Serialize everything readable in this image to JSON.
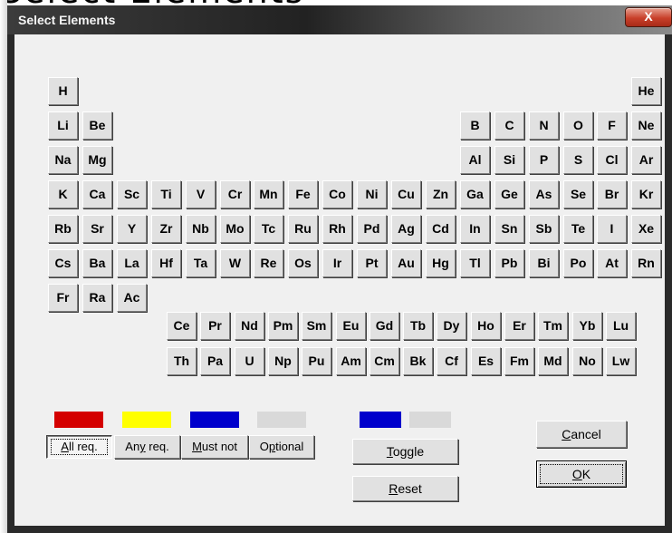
{
  "background_text": "Select Elements",
  "window": {
    "title": "Select Elements",
    "close_glyph": "X"
  },
  "main_rows": [
    [
      "H",
      null,
      null,
      null,
      null,
      null,
      null,
      null,
      null,
      null,
      null,
      null,
      null,
      null,
      null,
      null,
      null,
      "He"
    ],
    [
      "Li",
      "Be",
      null,
      null,
      null,
      null,
      null,
      null,
      null,
      null,
      null,
      null,
      "B",
      "C",
      "N",
      "O",
      "F",
      "Ne"
    ],
    [
      "Na",
      "Mg",
      null,
      null,
      null,
      null,
      null,
      null,
      null,
      null,
      null,
      null,
      "Al",
      "Si",
      "P",
      "S",
      "Cl",
      "Ar"
    ],
    [
      "K",
      "Ca",
      "Sc",
      "Ti",
      "V",
      "Cr",
      "Mn",
      "Fe",
      "Co",
      "Ni",
      "Cu",
      "Zn",
      "Ga",
      "Ge",
      "As",
      "Se",
      "Br",
      "Kr"
    ],
    [
      "Rb",
      "Sr",
      "Y",
      "Zr",
      "Nb",
      "Mo",
      "Tc",
      "Ru",
      "Rh",
      "Pd",
      "Ag",
      "Cd",
      "In",
      "Sn",
      "Sb",
      "Te",
      "I",
      "Xe"
    ],
    [
      "Cs",
      "Ba",
      "La",
      "Hf",
      "Ta",
      "W",
      "Re",
      "Os",
      "Ir",
      "Pt",
      "Au",
      "Hg",
      "Tl",
      "Pb",
      "Bi",
      "Po",
      "At",
      "Rn"
    ],
    [
      "Fr",
      "Ra",
      "Ac"
    ]
  ],
  "lanthanides": [
    "Ce",
    "Pr",
    "Nd",
    "Pm",
    "Sm",
    "Eu",
    "Gd",
    "Tb",
    "Dy",
    "Ho",
    "Er",
    "Tm",
    "Yb",
    "Lu"
  ],
  "actinides": [
    "Th",
    "Pa",
    "U",
    "Np",
    "Pu",
    "Am",
    "Cm",
    "Bk",
    "Cf",
    "Es",
    "Fm",
    "Md",
    "No",
    "Lw"
  ],
  "legend": {
    "colors": [
      "#d40000",
      "#ffff00",
      "#0000cc",
      "#d9d9d9"
    ],
    "buttons": [
      "All req.",
      "Any req.",
      "Must not",
      "Optional"
    ],
    "selected": "All req."
  },
  "toggle": {
    "colors": [
      "#0000cc",
      "#d9d9d9"
    ],
    "label": "Toggle"
  },
  "reset": {
    "label": "Reset"
  },
  "cancel": {
    "label": "Cancel"
  },
  "ok": {
    "label": "OK"
  }
}
